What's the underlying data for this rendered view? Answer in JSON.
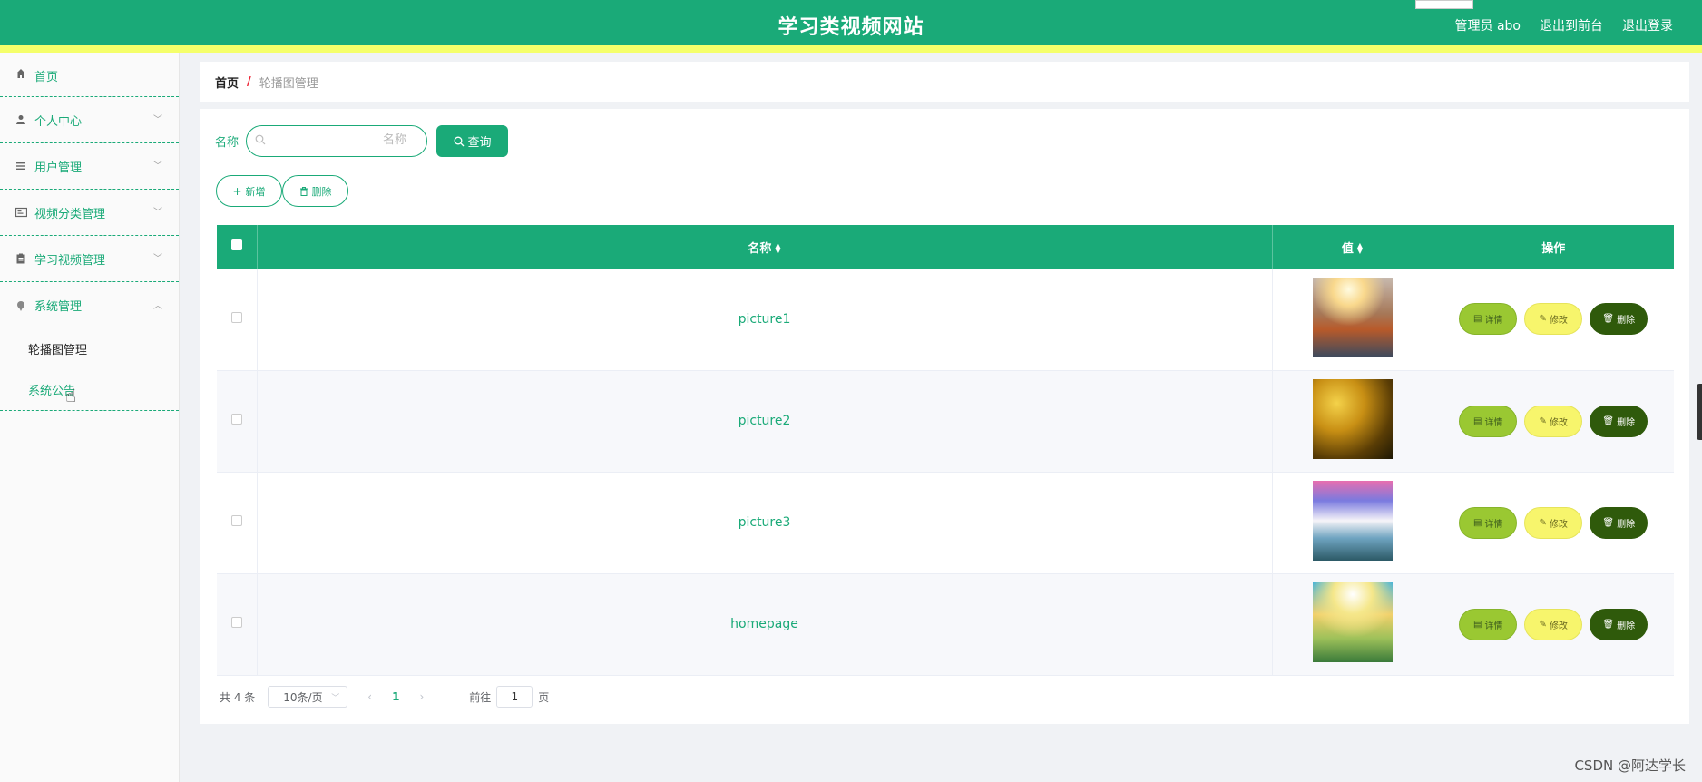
{
  "header": {
    "title": "学习类视频网站",
    "admin": "管理员 abo",
    "to_front": "退出到前台",
    "logout": "退出登录"
  },
  "sidebar": {
    "items": [
      {
        "label": "首页",
        "icon": "home-icon"
      },
      {
        "label": "个人中心",
        "icon": "user-icon"
      },
      {
        "label": "用户管理",
        "icon": "list-icon"
      },
      {
        "label": "视频分类管理",
        "icon": "card-icon"
      },
      {
        "label": "学习视频管理",
        "icon": "clipboard-icon"
      },
      {
        "label": "系统管理",
        "icon": "pin-icon"
      }
    ],
    "sub_items": [
      {
        "label": "轮播图管理"
      },
      {
        "label": "系统公告"
      }
    ]
  },
  "breadcrumb": {
    "home": "首页",
    "sep": "/",
    "current": "轮播图管理"
  },
  "search": {
    "label": "名称",
    "placeholder": "名称",
    "value": "",
    "button": "查询"
  },
  "actions": {
    "add": "新增",
    "delete": "删除"
  },
  "table": {
    "headers": {
      "name": "名称",
      "value": "值",
      "ops": "操作"
    },
    "rows": [
      {
        "name": "picture1",
        "thumb": "t1"
      },
      {
        "name": "picture2",
        "thumb": "t2"
      },
      {
        "name": "picture3",
        "thumb": "t3"
      },
      {
        "name": "homepage",
        "thumb": "t4"
      }
    ],
    "op_labels": {
      "detail": "详情",
      "edit": "修改",
      "delete": "删除"
    }
  },
  "pagination": {
    "total": "共 4 条",
    "page_size": "10条/页",
    "current_page": "1",
    "goto_label": "前往",
    "goto_value": "1",
    "page_unit": "页"
  },
  "watermark": "CSDN @阿达学长",
  "colors": {
    "primary": "#1aaa78",
    "accent_bar": "#f5ff6a",
    "detail": "#9ac832",
    "edit": "#f7f56c",
    "del": "#2f5a0b"
  }
}
